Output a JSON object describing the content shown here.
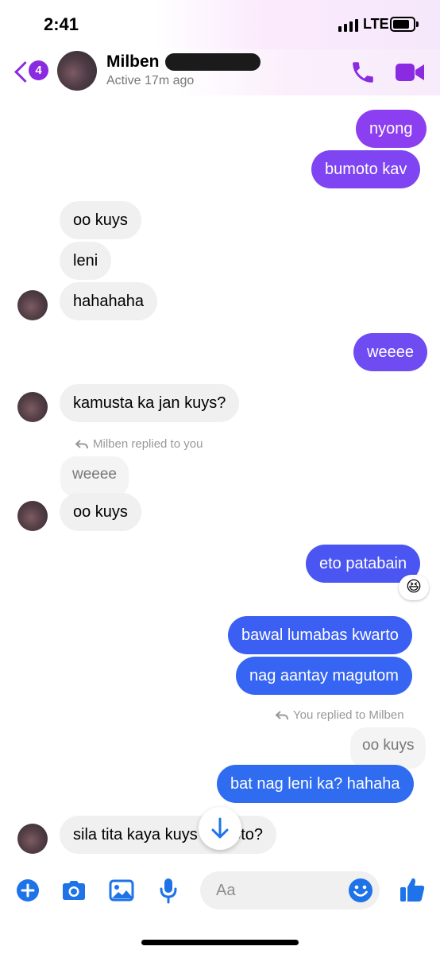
{
  "status_bar": {
    "time": "2:41",
    "network": "LTE"
  },
  "header": {
    "back_badge": "4",
    "contact_name": "Milben",
    "active_status": "Active 17m ago"
  },
  "messages": {
    "m1": "nyong",
    "m2": "bumoto kav",
    "m3": "oo kuys",
    "m4": "leni",
    "m5": "hahahaha",
    "m6": "weeee",
    "m7": "kamusta ka jan kuys?",
    "reply_note_1": "Milben replied to you",
    "quoted_1": "weeee",
    "m8": "oo kuys",
    "m9": "eto patabain",
    "reaction_9": "😆",
    "m10": "bawal lumabas kwarto",
    "m11": "nag aantay magutom",
    "reply_note_2": "You replied to Milben",
    "quoted_2": "oo kuys",
    "m12": "bat nag leni ka? hahaha",
    "m13": "sila tita kaya kuys ka boto?"
  },
  "composer": {
    "placeholder": "Aa"
  },
  "colors": {
    "purple": "#8a2be2",
    "violet_bubble": "#7a44f0",
    "blue_bubble": "#2f6cf0",
    "incoming_bubble": "#f0f0f0",
    "messenger_blue": "#1e73e8"
  }
}
